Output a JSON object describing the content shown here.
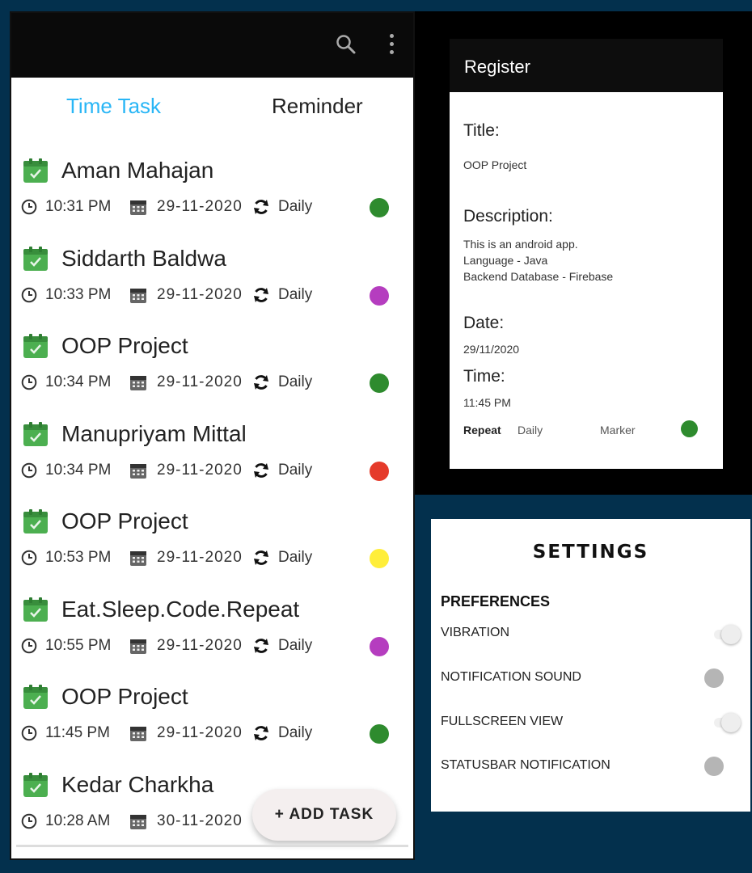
{
  "app": {
    "tabs": [
      {
        "label": "Time Task",
        "active": true
      },
      {
        "label": "Reminder",
        "active": false
      }
    ],
    "tasks": [
      {
        "title": "Aman Mahajan",
        "time": "10:31 PM",
        "date": "29-11-2020",
        "repeat": "Daily",
        "color": "#2e8b2e"
      },
      {
        "title": "Siddarth Baldwa",
        "time": "10:33 PM",
        "date": "29-11-2020",
        "repeat": "Daily",
        "color": "#b53dbf"
      },
      {
        "title": "OOP Project",
        "time": "10:34 PM",
        "date": "29-11-2020",
        "repeat": "Daily",
        "color": "#2e8b2e"
      },
      {
        "title": "Manupriyam Mittal",
        "time": "10:34 PM",
        "date": "29-11-2020",
        "repeat": "Daily",
        "color": "#e53a2a"
      },
      {
        "title": "OOP Project",
        "time": "10:53 PM",
        "date": "29-11-2020",
        "repeat": "Daily",
        "color": "#ffee3a"
      },
      {
        "title": "Eat.Sleep.Code.Repeat",
        "time": "10:55 PM",
        "date": "29-11-2020",
        "repeat": "Daily",
        "color": "#b53dbf"
      },
      {
        "title": "OOP Project",
        "time": "11:45 PM",
        "date": "29-11-2020",
        "repeat": "Daily",
        "color": "#2e8b2e"
      },
      {
        "title": "Kedar Charkha",
        "time": "10:28 AM",
        "date": "30-11-2020",
        "repeat": "",
        "color": ""
      }
    ],
    "fab_label": "+ ADD TASK",
    "icons": {
      "search": "search-icon",
      "more": "more-vert-icon"
    }
  },
  "register": {
    "header": "Register",
    "title_label": "Title:",
    "title_value": "OOP Project",
    "description_label": "Description:",
    "description_value": "This is an android app.\nLanguage - Java\nBackend Database - Firebase",
    "date_label": "Date:",
    "date_value": "29/11/2020",
    "time_label": "Time:",
    "time_value": "11:45 PM",
    "repeat_label": "Repeat",
    "repeat_value": "Daily",
    "marker_label": "Marker",
    "marker_color": "#2e8b2e"
  },
  "settings": {
    "title": "SETTINGS",
    "section": "PREFERENCES",
    "items": [
      {
        "label": "VIBRATION",
        "style": "light"
      },
      {
        "label": "NOTIFICATION SOUND",
        "style": "off"
      },
      {
        "label": "FULLSCREEN VIEW",
        "style": "light"
      },
      {
        "label": "STATUSBAR NOTIFICATION",
        "style": "off"
      }
    ]
  }
}
